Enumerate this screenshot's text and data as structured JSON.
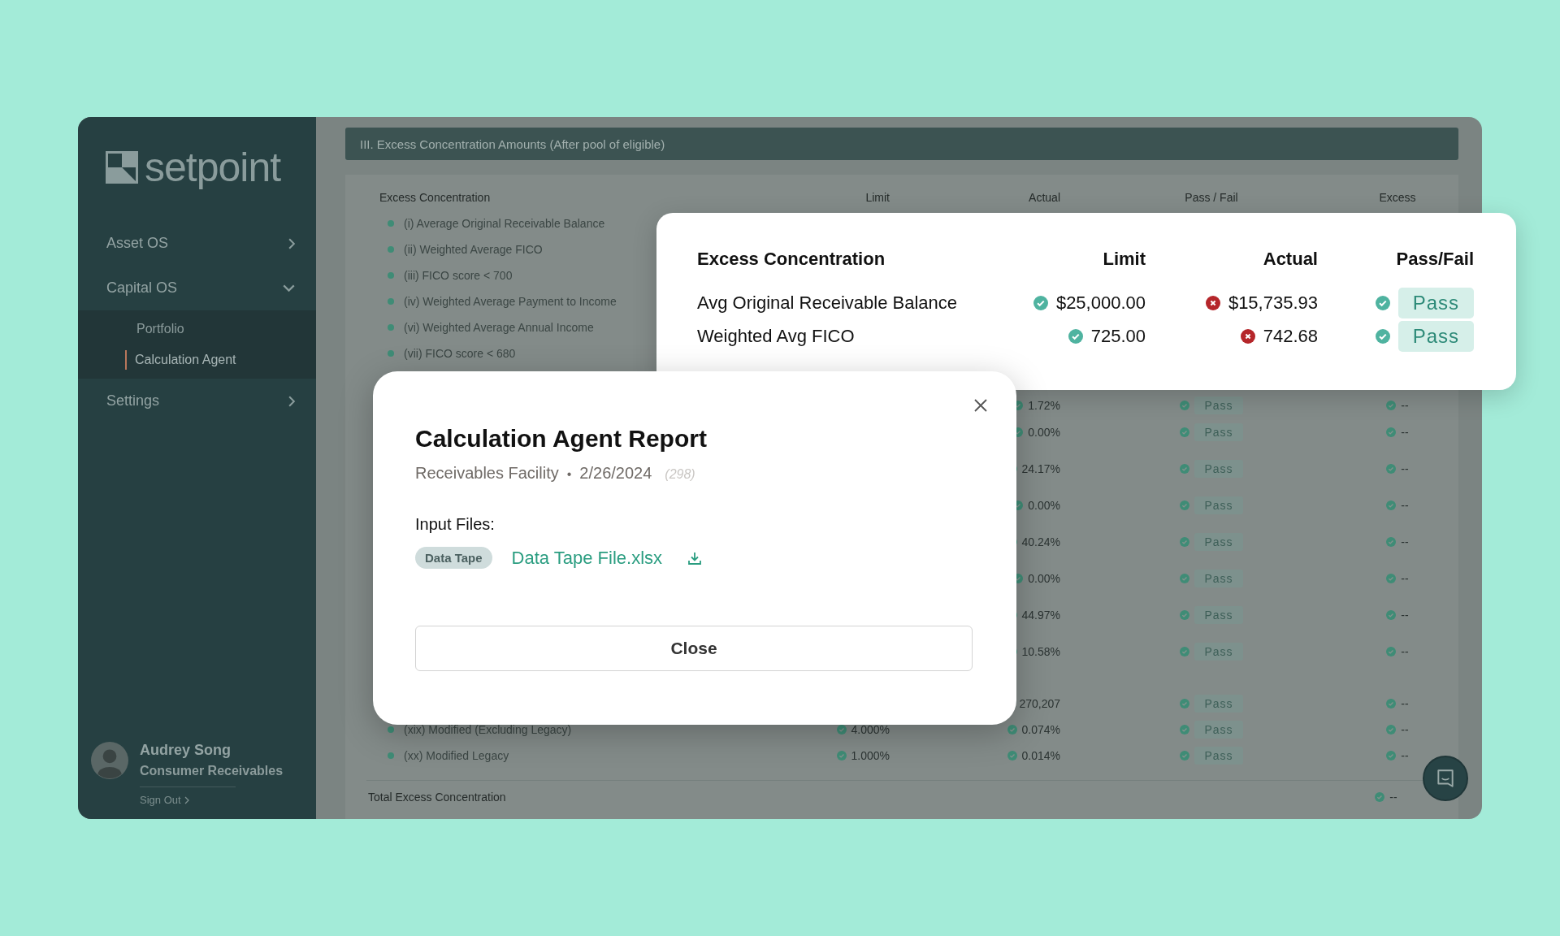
{
  "sidebar": {
    "logo": "setpoint",
    "items": [
      {
        "label": "Asset OS",
        "expanded": false
      },
      {
        "label": "Capital OS",
        "expanded": true,
        "children": [
          {
            "label": "Portfolio",
            "selected": false
          },
          {
            "label": "Calculation Agent",
            "selected": true
          }
        ]
      },
      {
        "label": "Settings",
        "expanded": false
      }
    ],
    "user": {
      "name": "Audrey Song",
      "team": "Consumer Receivables",
      "sign_out": "Sign Out"
    }
  },
  "section": {
    "title": "III. Excess Concentration Amounts (After pool of eligible)",
    "columns": [
      "Excess Concentration",
      "Limit",
      "Actual",
      "Pass / Fail",
      "Excess"
    ],
    "rows": [
      {
        "name": "(i) Average Original Receivable Balance"
      },
      {
        "name": "(ii) Weighted Average FICO"
      },
      {
        "name": "(iii) FICO score < 700"
      },
      {
        "name": "(iv) Weighted Average Payment to Income"
      },
      {
        "name": "(vi) Weighted Average Annual Income"
      },
      {
        "name": "(vii) FICO score < 680"
      },
      {
        "actual": "1.72%",
        "pass": "Pass",
        "passed": true,
        "excess": "--"
      },
      {
        "actual": "0.00%",
        "pass": "Pass",
        "passed": true,
        "excess": "--"
      },
      {
        "actual": "24.17%",
        "pass": "Pass",
        "passed": true,
        "excess": "--"
      },
      {
        "actual": "0.00%",
        "pass": "Pass",
        "passed": true,
        "excess": "--"
      },
      {
        "actual": "40.24%",
        "pass": "Pass",
        "passed": true,
        "excess": "--"
      },
      {
        "actual": "0.00%",
        "pass": "Pass",
        "passed": true,
        "excess": "--"
      },
      {
        "actual": "44.97%",
        "pass": "Pass",
        "passed": true,
        "excess": "--"
      },
      {
        "actual": "10.58%",
        "pass": "Pass",
        "passed": true,
        "excess": "--"
      },
      {
        "actual": "270,207",
        "pass": "Pass",
        "passed": true,
        "excess": "--"
      },
      {
        "name": "(xix) Modified (Excluding Legacy)",
        "limit": "4.000%",
        "actual": "0.074%",
        "pass": "Pass",
        "passed": true,
        "excess": "--"
      },
      {
        "name": "(xx) Modified Legacy",
        "limit": "1.000%",
        "actual": "0.014%",
        "pass": "Pass",
        "passed": true,
        "excess": "--"
      }
    ],
    "total": {
      "label": "Total Excess Concentration",
      "excess": "--"
    }
  },
  "summary_card": {
    "columns": [
      "Excess Concentration",
      "Limit",
      "Actual",
      "Pass/Fail"
    ],
    "rows": [
      {
        "name": "Avg Original Receivable Balance",
        "limit": "$25,000.00",
        "limit_ok": true,
        "actual": "$15,735.93",
        "actual_ok": false,
        "result": "Pass",
        "result_ok": true
      },
      {
        "name": "Weighted Avg FICO",
        "limit": "725.00",
        "limit_ok": true,
        "actual": "742.68",
        "actual_ok": false,
        "result": "Pass",
        "result_ok": true
      }
    ]
  },
  "modal": {
    "title": "Calculation Agent Report",
    "facility": "Receivables Facility",
    "separator": "•",
    "date": "2/26/2024",
    "count": "(298)",
    "files_label": "Input Files:",
    "files": [
      {
        "tag": "Data Tape",
        "name": "Data Tape File.xlsx"
      }
    ],
    "close_label": "Close"
  }
}
